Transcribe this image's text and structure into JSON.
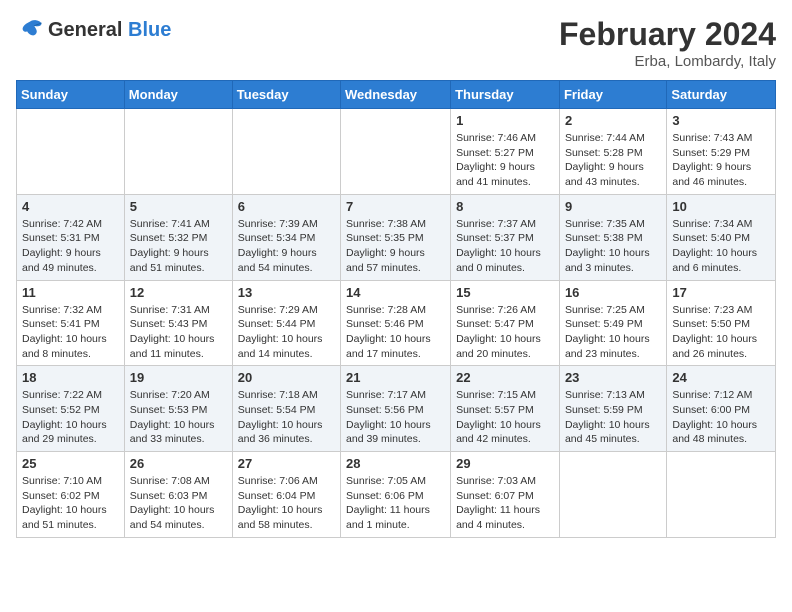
{
  "header": {
    "logo_general": "General",
    "logo_blue": "Blue",
    "main_title": "February 2024",
    "subtitle": "Erba, Lombardy, Italy"
  },
  "weekdays": [
    "Sunday",
    "Monday",
    "Tuesday",
    "Wednesday",
    "Thursday",
    "Friday",
    "Saturday"
  ],
  "weeks": [
    [
      {
        "day": "",
        "info": ""
      },
      {
        "day": "",
        "info": ""
      },
      {
        "day": "",
        "info": ""
      },
      {
        "day": "",
        "info": ""
      },
      {
        "day": "1",
        "info": "Sunrise: 7:46 AM\nSunset: 5:27 PM\nDaylight: 9 hours and 41 minutes."
      },
      {
        "day": "2",
        "info": "Sunrise: 7:44 AM\nSunset: 5:28 PM\nDaylight: 9 hours and 43 minutes."
      },
      {
        "day": "3",
        "info": "Sunrise: 7:43 AM\nSunset: 5:29 PM\nDaylight: 9 hours and 46 minutes."
      }
    ],
    [
      {
        "day": "4",
        "info": "Sunrise: 7:42 AM\nSunset: 5:31 PM\nDaylight: 9 hours and 49 minutes."
      },
      {
        "day": "5",
        "info": "Sunrise: 7:41 AM\nSunset: 5:32 PM\nDaylight: 9 hours and 51 minutes."
      },
      {
        "day": "6",
        "info": "Sunrise: 7:39 AM\nSunset: 5:34 PM\nDaylight: 9 hours and 54 minutes."
      },
      {
        "day": "7",
        "info": "Sunrise: 7:38 AM\nSunset: 5:35 PM\nDaylight: 9 hours and 57 minutes."
      },
      {
        "day": "8",
        "info": "Sunrise: 7:37 AM\nSunset: 5:37 PM\nDaylight: 10 hours and 0 minutes."
      },
      {
        "day": "9",
        "info": "Sunrise: 7:35 AM\nSunset: 5:38 PM\nDaylight: 10 hours and 3 minutes."
      },
      {
        "day": "10",
        "info": "Sunrise: 7:34 AM\nSunset: 5:40 PM\nDaylight: 10 hours and 6 minutes."
      }
    ],
    [
      {
        "day": "11",
        "info": "Sunrise: 7:32 AM\nSunset: 5:41 PM\nDaylight: 10 hours and 8 minutes."
      },
      {
        "day": "12",
        "info": "Sunrise: 7:31 AM\nSunset: 5:43 PM\nDaylight: 10 hours and 11 minutes."
      },
      {
        "day": "13",
        "info": "Sunrise: 7:29 AM\nSunset: 5:44 PM\nDaylight: 10 hours and 14 minutes."
      },
      {
        "day": "14",
        "info": "Sunrise: 7:28 AM\nSunset: 5:46 PM\nDaylight: 10 hours and 17 minutes."
      },
      {
        "day": "15",
        "info": "Sunrise: 7:26 AM\nSunset: 5:47 PM\nDaylight: 10 hours and 20 minutes."
      },
      {
        "day": "16",
        "info": "Sunrise: 7:25 AM\nSunset: 5:49 PM\nDaylight: 10 hours and 23 minutes."
      },
      {
        "day": "17",
        "info": "Sunrise: 7:23 AM\nSunset: 5:50 PM\nDaylight: 10 hours and 26 minutes."
      }
    ],
    [
      {
        "day": "18",
        "info": "Sunrise: 7:22 AM\nSunset: 5:52 PM\nDaylight: 10 hours and 29 minutes."
      },
      {
        "day": "19",
        "info": "Sunrise: 7:20 AM\nSunset: 5:53 PM\nDaylight: 10 hours and 33 minutes."
      },
      {
        "day": "20",
        "info": "Sunrise: 7:18 AM\nSunset: 5:54 PM\nDaylight: 10 hours and 36 minutes."
      },
      {
        "day": "21",
        "info": "Sunrise: 7:17 AM\nSunset: 5:56 PM\nDaylight: 10 hours and 39 minutes."
      },
      {
        "day": "22",
        "info": "Sunrise: 7:15 AM\nSunset: 5:57 PM\nDaylight: 10 hours and 42 minutes."
      },
      {
        "day": "23",
        "info": "Sunrise: 7:13 AM\nSunset: 5:59 PM\nDaylight: 10 hours and 45 minutes."
      },
      {
        "day": "24",
        "info": "Sunrise: 7:12 AM\nSunset: 6:00 PM\nDaylight: 10 hours and 48 minutes."
      }
    ],
    [
      {
        "day": "25",
        "info": "Sunrise: 7:10 AM\nSunset: 6:02 PM\nDaylight: 10 hours and 51 minutes."
      },
      {
        "day": "26",
        "info": "Sunrise: 7:08 AM\nSunset: 6:03 PM\nDaylight: 10 hours and 54 minutes."
      },
      {
        "day": "27",
        "info": "Sunrise: 7:06 AM\nSunset: 6:04 PM\nDaylight: 10 hours and 58 minutes."
      },
      {
        "day": "28",
        "info": "Sunrise: 7:05 AM\nSunset: 6:06 PM\nDaylight: 11 hours and 1 minute."
      },
      {
        "day": "29",
        "info": "Sunrise: 7:03 AM\nSunset: 6:07 PM\nDaylight: 11 hours and 4 minutes."
      },
      {
        "day": "",
        "info": ""
      },
      {
        "day": "",
        "info": ""
      }
    ]
  ]
}
